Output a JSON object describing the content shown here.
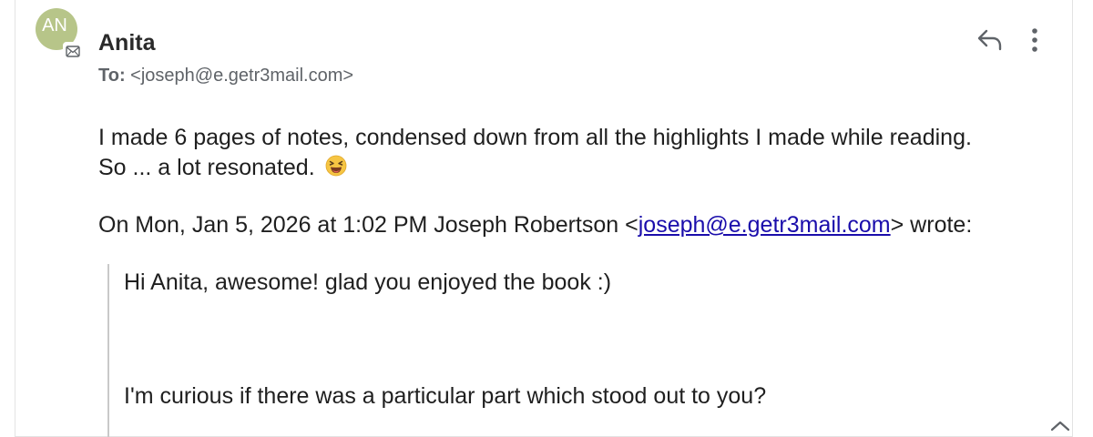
{
  "message": {
    "avatar_initials": "AN",
    "sender_name": "Anita",
    "to_label": "To:",
    "to_address": "<joseph@e.getr3mail.com>",
    "icons": {
      "avatar_badge": "envelope-icon",
      "reply": "reply-icon",
      "more": "more-vert-icon",
      "corner": "chevron-icon"
    },
    "body_line1": "I made 6 pages of notes, condensed down from all the highlights I made while reading.",
    "body_line2": "So ... a lot resonated.",
    "emoji": "😆",
    "quote_header_prefix": "On Mon, Jan 5, 2026 at 1:02 PM Joseph Robertson <",
    "quote_header_email": "joseph@e.getr3mail.com",
    "quote_header_suffix": "> wrote:",
    "quoted": {
      "line1": "Hi Anita, awesome! glad you enjoyed the book :)",
      "line2": "I'm curious if there was a particular part which stood out to you?"
    }
  },
  "colors": {
    "avatar_bg": "#b7c589",
    "link": "#1a0dab",
    "quote_bar": "#c9c9c9",
    "secondary_text": "#5f6368"
  }
}
